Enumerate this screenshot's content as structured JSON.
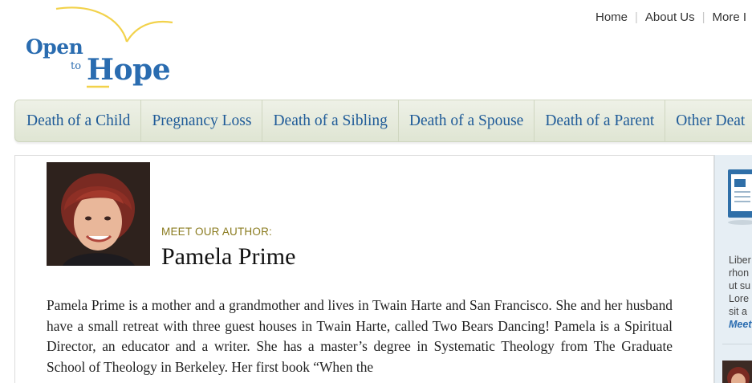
{
  "logo": {
    "word1": "Open",
    "word2": "to",
    "word3": "Hope"
  },
  "top_nav": {
    "items": [
      "Home",
      "About Us",
      "More I"
    ]
  },
  "category_nav": {
    "items": [
      "Death of a Child",
      "Pregnancy Loss",
      "Death of a Sibling",
      "Death of a Spouse",
      "Death of a Parent",
      "Other Deat"
    ]
  },
  "author": {
    "kicker": "MEET OUR AUTHOR:",
    "name": "Pamela Prime",
    "bio": "Pamela Prime is a mother and a grandmother and lives in Twain Harte and San Francisco. She and her husband have a small retreat with three guest houses in Twain Harte, called Two Bears Dancing! Pamela is a Spiritual Director, an educator and a writer. She has a master’s degree in Systematic Theology from The Graduate School of Theology in Berkeley. Her first book “When the"
  },
  "sidebar": {
    "lines": [
      "Liber",
      "rhon",
      "ut su",
      "Lore",
      "sit a"
    ],
    "more_label": "Meet"
  },
  "colors": {
    "brand_blue": "#2a6cb0",
    "nav_link": "#1f5b98",
    "kicker": "#8a7b1f",
    "logo_swoosh": "#f2d24b"
  }
}
